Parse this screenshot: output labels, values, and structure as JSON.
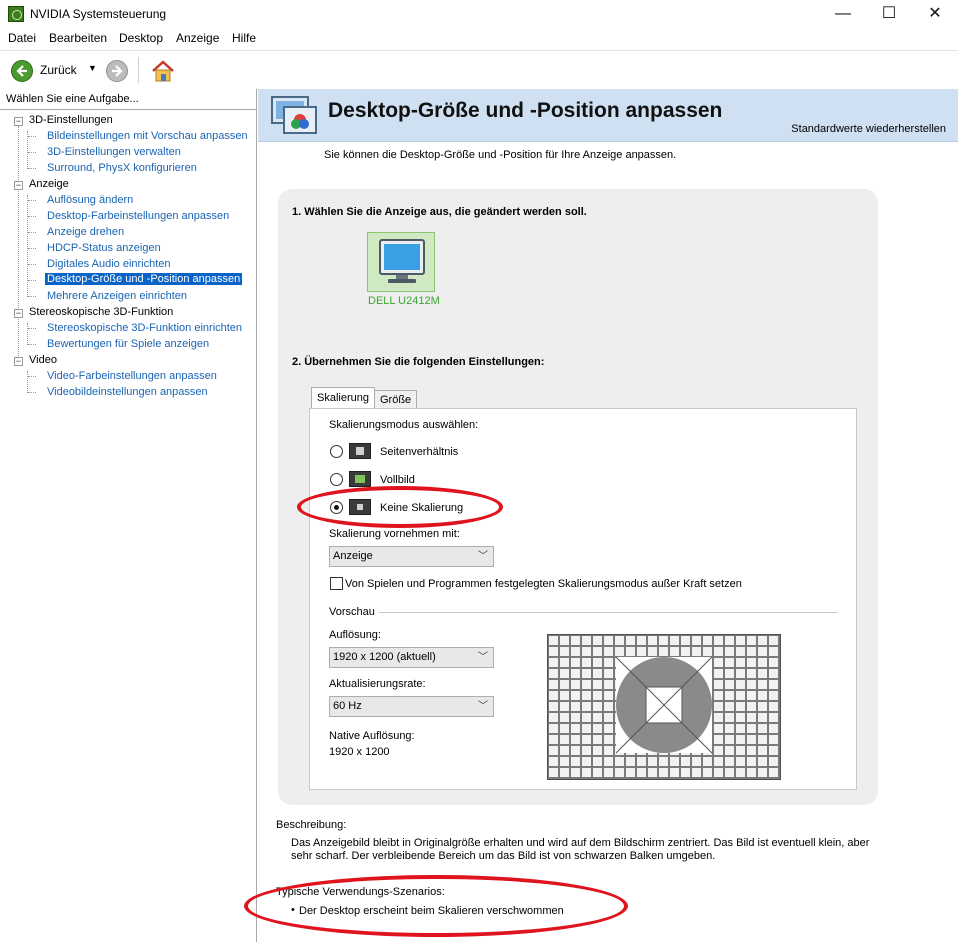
{
  "window": {
    "title": "NVIDIA Systemsteuerung",
    "minimize": "—",
    "maximize": "☐",
    "close": "✕"
  },
  "menu": [
    "Datei",
    "Bearbeiten",
    "Desktop",
    "Anzeige",
    "Hilfe"
  ],
  "toolbar": {
    "back_label": "Zurück",
    "back_dropdown": "▼"
  },
  "tasks": {
    "header": "Wählen Sie eine Aufgabe...",
    "categories": [
      {
        "label": "3D-Einstellungen",
        "items": [
          "Bildeinstellungen mit Vorschau anpassen",
          "3D-Einstellungen verwalten",
          "Surround, PhysX konfigurieren"
        ]
      },
      {
        "label": "Anzeige",
        "items": [
          "Auflösung ändern",
          "Desktop-Farbeinstellungen anpassen",
          "Anzeige drehen",
          "HDCP-Status anzeigen",
          "Digitales Audio einrichten",
          "Desktop-Größe und -Position anpassen",
          "Mehrere Anzeigen einrichten"
        ]
      },
      {
        "label": "Stereoskopische 3D-Funktion",
        "items": [
          "Stereoskopische 3D-Funktion einrichten",
          "Bewertungen für Spiele anzeigen"
        ]
      },
      {
        "label": "Video",
        "items": [
          "Video-Farbeinstellungen anpassen",
          "Videobildeinstellungen anpassen"
        ]
      }
    ],
    "selected": "Desktop-Größe und -Position anpassen"
  },
  "page": {
    "title": "Desktop-Größe und -Position anpassen",
    "restore": "Standardwerte wiederherstellen",
    "description": "Sie können die Desktop-Größe und -Position für Ihre Anzeige anpassen.",
    "step1": "1. Wählen Sie die Anzeige aus, die geändert werden soll.",
    "display_name": "DELL U2412M",
    "step2": "2. Übernehmen Sie die folgenden Einstellungen:",
    "tabs": [
      "Skalierung",
      "Größe"
    ],
    "scaling_mode_label": "Skalierungsmodus auswählen:",
    "modes": [
      "Seitenverhältnis",
      "Vollbild",
      "Keine Skalierung"
    ],
    "perform_label": "Skalierung vornehmen mit:",
    "perform_value": "Anzeige",
    "override_label": "Von Spielen und Programmen festgelegten Skalierungsmodus außer Kraft setzen",
    "preview_label": "Vorschau",
    "resolution_label": "Auflösung:",
    "resolution_value": "1920 x 1200 (aktuell)",
    "refresh_label": "Aktualisierungsrate:",
    "refresh_value": "60 Hz",
    "native_label": "Native Auflösung:",
    "native_value": "1920 x 1200",
    "desc_heading": "Beschreibung:",
    "desc_text": "Das Anzeigebild bleibt in Originalgröße erhalten und wird auf dem Bildschirm zentriert. Das Bild ist eventuell klein, aber sehr scharf. Der verbleibende Bereich um das Bild ist von schwarzen Balken umgeben.",
    "usage_heading": "Typische Verwendungs-Szenarios:",
    "usage_item": "Der Desktop erscheint beim Skalieren verschwommen"
  },
  "colors": {
    "annotation": "#e0141e",
    "link": "#1a64b4",
    "selection": "#0a64c8",
    "header_bg": "#cfe0f3"
  }
}
